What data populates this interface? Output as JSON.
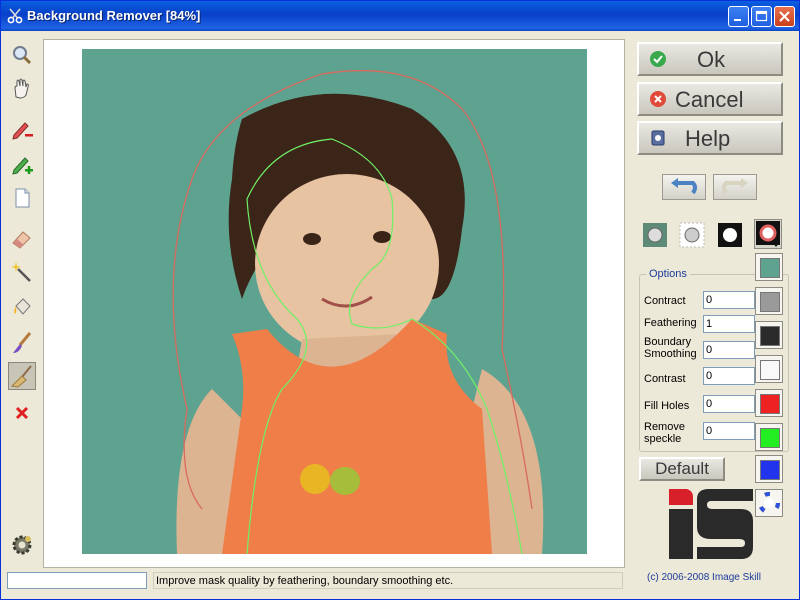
{
  "window": {
    "title": "Background Remover [84%]",
    "icon": "scissors-icon"
  },
  "title_buttons": [
    "minimize-icon",
    "maximize-icon",
    "close-icon"
  ],
  "left_tools": [
    {
      "name": "zoom-tool",
      "icon": "magnifier-icon"
    },
    {
      "name": "pan-tool",
      "icon": "hand-icon"
    },
    {
      "name": "erase-marker-tool",
      "icon": "red-pencil-minus-icon"
    },
    {
      "name": "add-marker-tool",
      "icon": "green-pencil-plus-icon"
    },
    {
      "name": "new-document-tool",
      "icon": "page-icon"
    },
    {
      "name": "eraser-tool",
      "icon": "eraser-icon"
    },
    {
      "name": "magic-wand-tool",
      "icon": "magic-wand-icon"
    },
    {
      "name": "fill-tool",
      "icon": "paint-bucket-icon"
    },
    {
      "name": "brush-tool",
      "icon": "brush-icon"
    },
    {
      "name": "broom-tool",
      "icon": "broom-icon",
      "active": true
    },
    {
      "name": "clear-tool",
      "icon": "red-x-icon"
    }
  ],
  "settings_icon": "gear-icon",
  "buttons": {
    "ok": "Ok",
    "cancel": "Cancel",
    "help": "Help",
    "default": "Default"
  },
  "button_icons": {
    "ok": "check-icon",
    "cancel": "x-circle-icon",
    "help": "help-book-icon"
  },
  "history": {
    "undo_icon": "undo-arrow-icon",
    "redo_icon": "redo-arrow-icon"
  },
  "view_modes": [
    "original-image-icon",
    "transparent-background-icon",
    "mask-view-icon",
    "color-picker-icon"
  ],
  "options": {
    "legend": "Options",
    "rows": [
      {
        "label": "Contract",
        "value": "0"
      },
      {
        "label": "Feathering",
        "value": "1"
      },
      {
        "label": "Boundary Smoothing",
        "value": "0"
      },
      {
        "label": "Contrast",
        "value": "0"
      },
      {
        "label": "Fill Holes",
        "value": "0"
      },
      {
        "label": "Remove speckle",
        "value": "0"
      }
    ]
  },
  "swatches": [
    "#5ea390",
    "#9a9a9a",
    "#2b2b2b",
    "#f9f9f9",
    "#ee2222",
    "#22ee22",
    "#2233ee"
  ],
  "copyright": "(c) 2006-2008 Image Skill",
  "status": {
    "message": "Improve mask quality by feathering, boundary smoothing etc."
  }
}
